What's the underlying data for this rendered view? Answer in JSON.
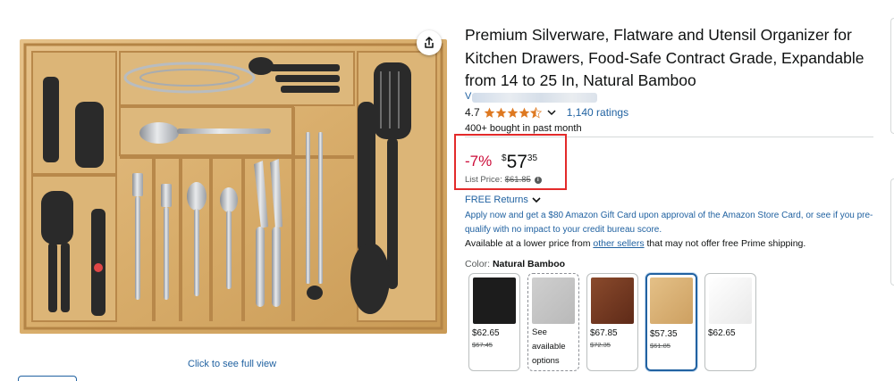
{
  "product": {
    "title": "Premium Silverware, Flatware and Utensil Organizer for Kitchen Drawers, Food-Safe Contract Grade, Expandable from 14 to 25 In, Natural Bamboo",
    "brand_prefix": "V",
    "image_alt": "Bamboo expandable drawer organizer filled with kitchen utensils and silverware",
    "see_full_view": "Click to see full view",
    "share_icon": "share-icon"
  },
  "rating": {
    "value": "4.7",
    "stars": 4.5,
    "count_label": "1,140 ratings",
    "bought": "400+ bought in past month"
  },
  "price": {
    "discount": "-7%",
    "symbol": "$",
    "whole": "57",
    "fraction": "35",
    "list_label": "List Price:",
    "list_value": "$61.85"
  },
  "returns": {
    "label": "FREE Returns"
  },
  "offer": {
    "apply_text": "Apply now and get a $80 Amazon Gift Card upon approval of the Amazon Store Card, or see if you pre-qualify with no impact to your credit bureau score.",
    "lower_prefix": "Available at a lower price from ",
    "lower_link": "other sellers",
    "lower_suffix": " that may not offer free Prime shipping."
  },
  "color": {
    "label": "Color: ",
    "selected": "Natural Bamboo",
    "options": [
      {
        "price": "$62.65",
        "list": "$67.45",
        "swatch": "#1a1a1a"
      },
      {
        "see_text": "See available options",
        "swatch": "#c9c9c9"
      },
      {
        "price": "$67.85",
        "list": "$72.35",
        "swatch": "#7a3a22"
      },
      {
        "price": "$57.35",
        "list": "$61.85",
        "swatch": "#d9b173"
      },
      {
        "price": "$62.65",
        "list": "",
        "swatch": "#f2f2f2"
      }
    ]
  },
  "colors": {
    "link": "#2162a1",
    "discount": "#cc0c39",
    "highlight_box": "#e32a2a"
  }
}
